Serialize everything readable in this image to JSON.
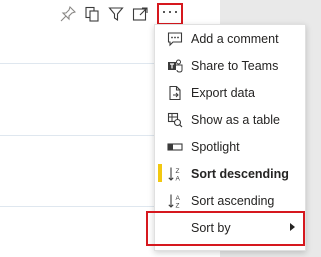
{
  "toolbar": {
    "icons": [
      "pin-icon",
      "copy-icon",
      "filter-icon",
      "focus-mode-icon",
      "more-options-icon"
    ],
    "more_label": "···"
  },
  "menu": {
    "items": [
      {
        "label": "Add a comment",
        "icon": "comment-icon"
      },
      {
        "label": "Share to Teams",
        "icon": "teams-icon"
      },
      {
        "label": "Export data",
        "icon": "export-icon"
      },
      {
        "label": "Show as a table",
        "icon": "table-icon"
      },
      {
        "label": "Spotlight",
        "icon": "spotlight-icon"
      },
      {
        "label": "Sort descending",
        "icon": "sort-descending-icon",
        "active": true
      },
      {
        "label": "Sort ascending",
        "icon": "sort-ascending-icon"
      },
      {
        "label": "Sort by",
        "icon": "",
        "submenu": true
      }
    ]
  },
  "colors": {
    "accent_yellow": "#f2c811",
    "highlight_red": "#d6181e",
    "gutter": "#e9e9e9"
  }
}
